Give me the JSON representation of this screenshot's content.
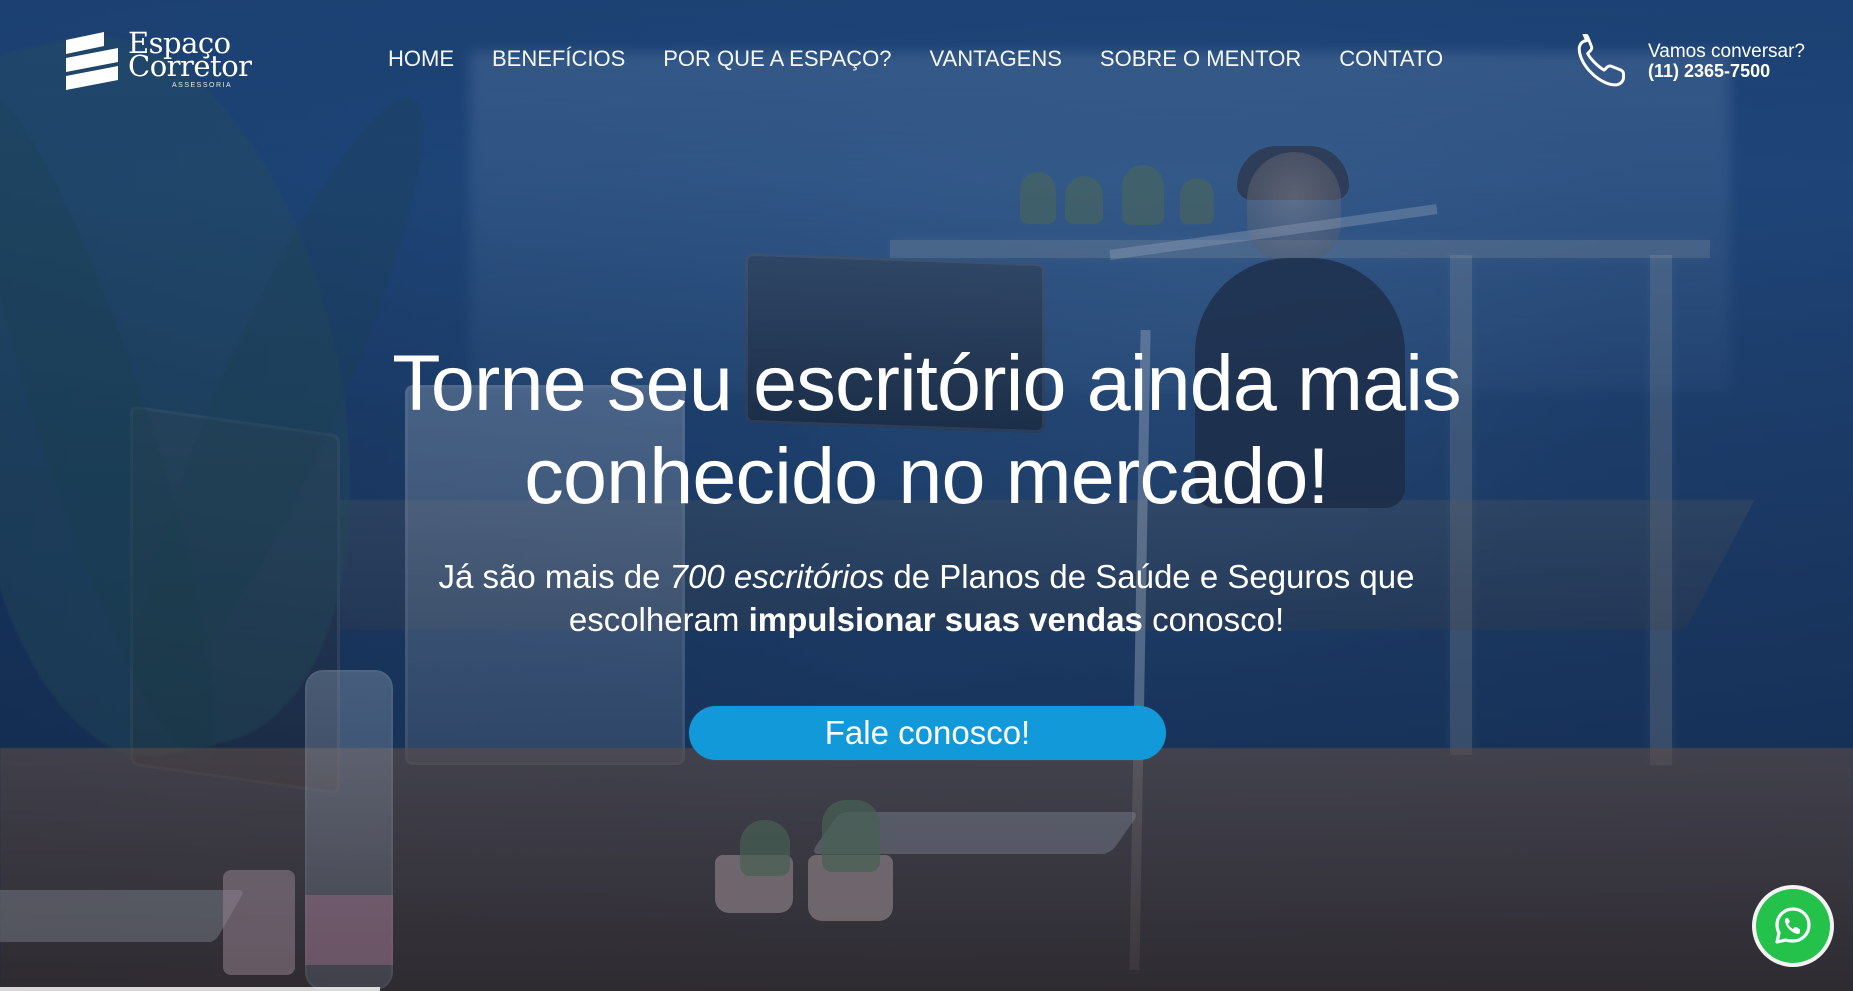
{
  "brand": {
    "name_line1": "Espaço",
    "name_line2": "Corretor",
    "subtitle": "ASSESSORIA"
  },
  "nav": {
    "items": [
      {
        "label": "HOME"
      },
      {
        "label": "BENEFÍCIOS"
      },
      {
        "label": "POR QUE A ESPAÇO?"
      },
      {
        "label": "VANTAGENS"
      },
      {
        "label": "SOBRE O MENTOR"
      },
      {
        "label": "CONTATO"
      }
    ]
  },
  "contact": {
    "label": "Vamos conversar?",
    "phone": "(11) 2365-7500",
    "icon": "phone-icon"
  },
  "hero": {
    "title_line1": "Torne seu escritório ainda mais",
    "title_line2": "conhecido no mercado!",
    "subtitle_part1": "Já são mais de ",
    "subtitle_italic": "700 escritórios",
    "subtitle_part2": " de Planos de Saúde e Seguros que",
    "subtitle_part3": "escolheram ",
    "subtitle_bold": "impulsionar suas vendas",
    "subtitle_part4": " conosco!",
    "cta_label": "Fale conosco!"
  },
  "floating": {
    "whatsapp_icon": "whatsapp-icon"
  },
  "colors": {
    "cta": "#1199d9",
    "whatsapp": "#25c24b",
    "text": "#ffffff"
  }
}
